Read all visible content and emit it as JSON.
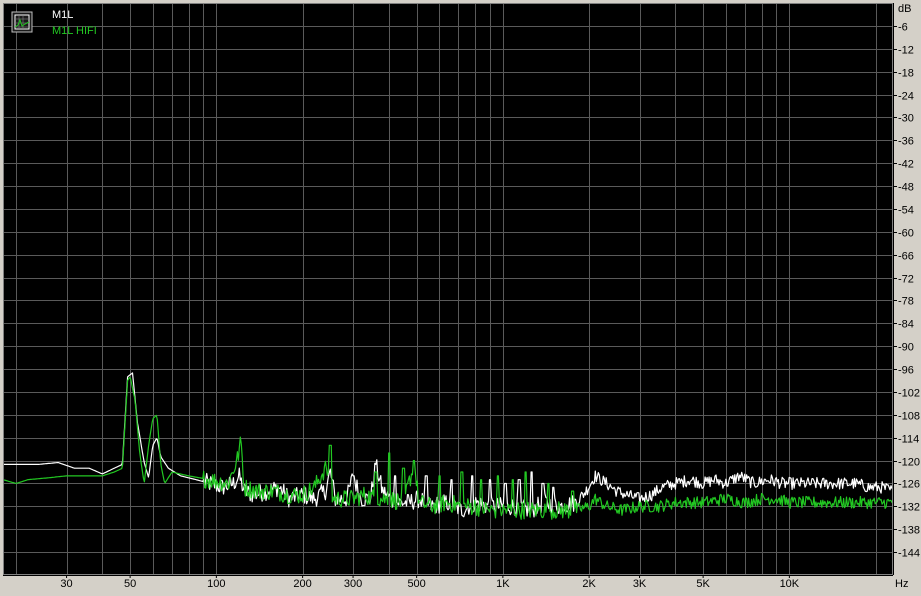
{
  "chart_data": {
    "type": "line",
    "y_unit": "dB",
    "x_unit": "Hz",
    "x_scale": "log",
    "xlim": [
      18,
      23000
    ],
    "ylim": [
      -150,
      0
    ],
    "grid": true,
    "background": "#000000",
    "legend_position": "top-left",
    "yticks": [
      -6,
      -12,
      -18,
      -24,
      -30,
      -36,
      -42,
      -48,
      -54,
      -60,
      -66,
      -72,
      -78,
      -84,
      -90,
      -96,
      -102,
      -108,
      -114,
      -120,
      -126,
      -132,
      -138,
      -144
    ],
    "xticks": [
      {
        "value": 30,
        "label": "30"
      },
      {
        "value": 50,
        "label": "50"
      },
      {
        "value": 100,
        "label": "100"
      },
      {
        "value": 200,
        "label": "200"
      },
      {
        "value": 300,
        "label": "300"
      },
      {
        "value": 500,
        "label": "500"
      },
      {
        "value": 1000,
        "label": "1K"
      },
      {
        "value": 2000,
        "label": "2K"
      },
      {
        "value": 3000,
        "label": "3K"
      },
      {
        "value": 5000,
        "label": "5K"
      },
      {
        "value": 10000,
        "label": "10K"
      }
    ],
    "series": [
      {
        "name": "M1L",
        "color": "#ffffff",
        "points": [
          [
            18,
            -121
          ],
          [
            20,
            -121
          ],
          [
            24,
            -121
          ],
          [
            28,
            -120.5
          ],
          [
            32,
            -122
          ],
          [
            36,
            -122
          ],
          [
            40,
            -123.5
          ],
          [
            44,
            -122
          ],
          [
            47,
            -121
          ],
          [
            49,
            -98
          ],
          [
            51,
            -97
          ],
          [
            53,
            -110
          ],
          [
            56,
            -120.5
          ],
          [
            58,
            -124.5
          ],
          [
            60,
            -116
          ],
          [
            62,
            -114
          ],
          [
            64,
            -119
          ],
          [
            68,
            -122
          ],
          [
            75,
            -124
          ],
          [
            85,
            -125
          ],
          [
            95,
            -126
          ],
          [
            105,
            -127
          ],
          [
            115,
            -126
          ],
          [
            120,
            -124
          ],
          [
            125,
            -128
          ],
          [
            135,
            -129
          ],
          [
            150,
            -128
          ],
          [
            165,
            -127
          ],
          [
            180,
            -130
          ],
          [
            200,
            -129
          ],
          [
            220,
            -130
          ],
          [
            240,
            -128
          ],
          [
            250,
            -123
          ],
          [
            260,
            -130
          ],
          [
            285,
            -130
          ],
          [
            300,
            -124
          ],
          [
            320,
            -130
          ],
          [
            345,
            -130
          ],
          [
            360,
            -121
          ],
          [
            380,
            -128
          ],
          [
            420,
            -131
          ],
          [
            470,
            -131
          ],
          [
            510,
            -130
          ],
          [
            560,
            -132
          ],
          [
            640,
            -131
          ],
          [
            720,
            -133
          ],
          [
            800,
            -131
          ],
          [
            900,
            -132
          ],
          [
            1000,
            -132
          ],
          [
            1100,
            -132
          ],
          [
            1250,
            -133
          ],
          [
            1400,
            -131
          ],
          [
            1600,
            -132
          ],
          [
            1800,
            -131
          ],
          [
            1950,
            -128
          ],
          [
            2100,
            -124
          ],
          [
            2300,
            -126
          ],
          [
            2500,
            -128
          ],
          [
            2700,
            -129
          ],
          [
            3000,
            -130
          ],
          [
            3300,
            -129
          ],
          [
            3600,
            -127
          ],
          [
            4000,
            -126
          ],
          [
            4500,
            -125
          ],
          [
            5000,
            -126
          ],
          [
            5500,
            -125
          ],
          [
            6000,
            -126
          ],
          [
            6700,
            -124
          ],
          [
            7500,
            -126
          ],
          [
            8500,
            -125
          ],
          [
            9500,
            -126
          ],
          [
            11000,
            -126
          ],
          [
            13000,
            -126
          ],
          [
            15000,
            -126
          ],
          [
            17000,
            -126
          ],
          [
            19000,
            -127
          ],
          [
            21000,
            -127
          ],
          [
            23000,
            -128
          ]
        ]
      },
      {
        "name": "M1L HIFI",
        "color": "#22c822",
        "points": [
          [
            18,
            -125
          ],
          [
            20,
            -126
          ],
          [
            22,
            -125
          ],
          [
            26,
            -124.5
          ],
          [
            30,
            -124
          ],
          [
            35,
            -124
          ],
          [
            40,
            -124
          ],
          [
            44,
            -123
          ],
          [
            47,
            -122
          ],
          [
            49,
            -99
          ],
          [
            50,
            -98
          ],
          [
            52,
            -104
          ],
          [
            54,
            -118
          ],
          [
            56,
            -126
          ],
          [
            58,
            -116
          ],
          [
            60,
            -109
          ],
          [
            62,
            -108
          ],
          [
            64,
            -121
          ],
          [
            66,
            -126
          ],
          [
            70,
            -123
          ],
          [
            80,
            -124
          ],
          [
            95,
            -125
          ],
          [
            110,
            -126
          ],
          [
            118,
            -120
          ],
          [
            122,
            -115
          ],
          [
            125,
            -127
          ],
          [
            140,
            -128
          ],
          [
            160,
            -128
          ],
          [
            180,
            -129
          ],
          [
            200,
            -129
          ],
          [
            220,
            -127
          ],
          [
            240,
            -122
          ],
          [
            255,
            -130
          ],
          [
            280,
            -130
          ],
          [
            300,
            -130
          ],
          [
            330,
            -129
          ],
          [
            360,
            -130
          ],
          [
            400,
            -130
          ],
          [
            450,
            -131
          ],
          [
            490,
            -121
          ],
          [
            510,
            -131
          ],
          [
            560,
            -132
          ],
          [
            640,
            -131
          ],
          [
            720,
            -132
          ],
          [
            800,
            -132
          ],
          [
            900,
            -133
          ],
          [
            1000,
            -133
          ],
          [
            1100,
            -133
          ],
          [
            1250,
            -133
          ],
          [
            1400,
            -133
          ],
          [
            1600,
            -133
          ],
          [
            1800,
            -133
          ],
          [
            2000,
            -132
          ],
          [
            2100,
            -130
          ],
          [
            2300,
            -132
          ],
          [
            2600,
            -133
          ],
          [
            3000,
            -132
          ],
          [
            3500,
            -132
          ],
          [
            4000,
            -131
          ],
          [
            4500,
            -131
          ],
          [
            5000,
            -131
          ],
          [
            6000,
            -130
          ],
          [
            7000,
            -131
          ],
          [
            8000,
            -130
          ],
          [
            9000,
            -130
          ],
          [
            10000,
            -131
          ],
          [
            12000,
            -131
          ],
          [
            14000,
            -131
          ],
          [
            16000,
            -131
          ],
          [
            18000,
            -131
          ],
          [
            20000,
            -131
          ],
          [
            23000,
            -131
          ]
        ]
      }
    ],
    "spikes": [
      {
        "series": 0,
        "f": 300,
        "y": -124
      },
      {
        "series": 0,
        "f": 360,
        "y": -121
      },
      {
        "series": 0,
        "f": 420,
        "y": -124
      },
      {
        "series": 0,
        "f": 540,
        "y": -124
      },
      {
        "series": 0,
        "f": 660,
        "y": -125
      },
      {
        "series": 0,
        "f": 780,
        "y": -124
      },
      {
        "series": 0,
        "f": 900,
        "y": -125
      },
      {
        "series": 0,
        "f": 1020,
        "y": -126
      },
      {
        "series": 0,
        "f": 1140,
        "y": -125
      },
      {
        "series": 0,
        "f": 1260,
        "y": -123
      },
      {
        "series": 0,
        "f": 1380,
        "y": -126
      },
      {
        "series": 0,
        "f": 1500,
        "y": -127
      },
      {
        "series": 1,
        "f": 240,
        "y": -122
      },
      {
        "series": 1,
        "f": 250,
        "y": -116
      },
      {
        "series": 1,
        "f": 360,
        "y": -123
      },
      {
        "series": 1,
        "f": 400,
        "y": -118
      },
      {
        "series": 1,
        "f": 450,
        "y": -122
      },
      {
        "series": 1,
        "f": 490,
        "y": -120
      },
      {
        "series": 1,
        "f": 600,
        "y": -124
      },
      {
        "series": 1,
        "f": 720,
        "y": -123
      },
      {
        "series": 1,
        "f": 840,
        "y": -125
      },
      {
        "series": 1,
        "f": 960,
        "y": -124
      },
      {
        "series": 1,
        "f": 1080,
        "y": -125
      },
      {
        "series": 1,
        "f": 1200,
        "y": -123
      },
      {
        "series": 1,
        "f": 1440,
        "y": -126
      },
      {
        "series": 1,
        "f": 1750,
        "y": -128
      }
    ]
  },
  "legend": {
    "icon": "chart-icon",
    "items": [
      {
        "label": "M1L",
        "color": "#ffffff"
      },
      {
        "label": "M1L HIFI",
        "color": "#22c822"
      }
    ]
  },
  "axis_labels": {
    "y_unit_label": "dB",
    "x_unit_label": "Hz"
  }
}
